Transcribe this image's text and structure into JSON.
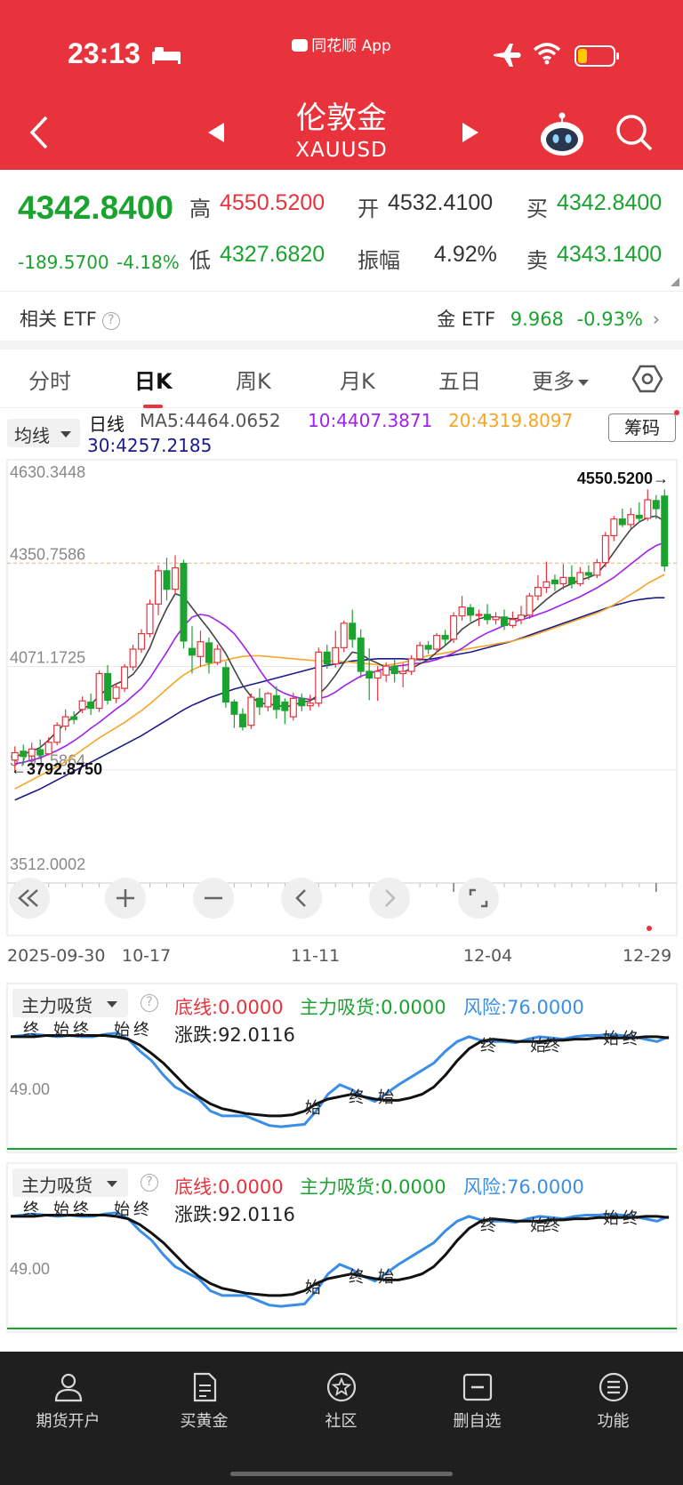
{
  "status_bar": {
    "time": "23:13",
    "app_name": "同花顺 App"
  },
  "header": {
    "title": "伦敦金",
    "subtitle": "XAUUSD"
  },
  "quote": {
    "price": "4342.8400",
    "change": "-189.5700",
    "change_pct": "-4.18%",
    "high_label": "高",
    "high": "4550.5200",
    "low_label": "低",
    "low": "4327.6820",
    "open_label": "开",
    "open": "4532.4100",
    "amp_label": "振幅",
    "amp": "4.92%",
    "buy_label": "买",
    "buy": "4342.8400",
    "sell_label": "卖",
    "sell": "4343.1400"
  },
  "etf": {
    "label": "相关 ETF",
    "name": "金 ETF",
    "value": "9.968",
    "pct": "-0.93%"
  },
  "tabs": [
    "分时",
    "日K",
    "周K",
    "月K",
    "五日",
    "更多"
  ],
  "ma": {
    "select": "均线",
    "prefix": "日线",
    "ma5": "MA5:4464.0652",
    "ma10": "10:4407.3871",
    "ma20": "20:4319.8097",
    "ma30": "30:4257.2185",
    "chip_button": "筹码"
  },
  "price_axis": [
    "4630.3448",
    "4350.7586",
    "4071.1725",
    "3791.5864",
    "3512.0002"
  ],
  "annotations": {
    "high_marker": "4550.5200→",
    "low_marker": "←3792.8750"
  },
  "dates": [
    "2025-09-30",
    "10-17",
    "11-11",
    "12-04",
    "12-29"
  ],
  "indicator": {
    "select": "主力吸货",
    "line_bottom": "底线:0.0000",
    "line_main": "主力吸货:0.0000",
    "line_risk": "风险:76.0000",
    "line_change": "涨跌:92.0116",
    "axis": "49.00",
    "marker_start": "始",
    "marker_end": "终"
  },
  "bottom_nav": [
    {
      "label": "期货开户",
      "icon": "person-icon"
    },
    {
      "label": "买黄金",
      "icon": "document-icon"
    },
    {
      "label": "社区",
      "icon": "community-icon"
    },
    {
      "label": "删自选",
      "icon": "remove-watch-icon"
    },
    {
      "label": "功能",
      "icon": "menu-icon"
    }
  ],
  "colors": {
    "brand": "#e8333c",
    "up": "#e8333c",
    "down": "#1aa32f",
    "ma5": "#444444",
    "ma10": "#a020f0",
    "ma20": "#f5a623",
    "ma30": "#1a1a8c",
    "risk": "#3a8ee6",
    "main": "#111111",
    "bottom_line": "#1aa32f"
  },
  "chart_data": [
    {
      "type": "candlestick",
      "title": "",
      "ylim": [
        3512.0002,
        4630.3448
      ],
      "y_ticks": [
        4630.3448,
        4350.7586,
        4071.1725,
        3791.5864,
        3512.0002
      ],
      "x_ticks": [
        "2025-09-30",
        "10-17",
        "11-11",
        "12-04",
        "12-29"
      ],
      "high_marker": 4550.52,
      "low_marker": 3792.875,
      "candles": [
        [
          3818,
          3838,
          3785,
          3855
        ],
        [
          3842,
          3828,
          3805,
          3860
        ],
        [
          3829,
          3848,
          3810,
          3865
        ],
        [
          3846,
          3832,
          3820,
          3874
        ],
        [
          3835,
          3866,
          3830,
          3880
        ],
        [
          3866,
          3912,
          3858,
          3920
        ],
        [
          3910,
          3935,
          3898,
          3955
        ],
        [
          3935,
          3928,
          3915,
          3950
        ],
        [
          3955,
          3978,
          3945,
          3990
        ],
        [
          3975,
          3958,
          3940,
          3998
        ],
        [
          3958,
          4052,
          3948,
          4060
        ],
        [
          4052,
          3980,
          3968,
          4075
        ],
        [
          3985,
          4015,
          3972,
          4025
        ],
        [
          4012,
          4070,
          4002,
          4078
        ],
        [
          4070,
          4118,
          4060,
          4130
        ],
        [
          4118,
          4160,
          4108,
          4172
        ],
        [
          4160,
          4240,
          4150,
          4252
        ],
        [
          4240,
          4330,
          4210,
          4345
        ],
        [
          4330,
          4280,
          4250,
          4365
        ],
        [
          4280,
          4338,
          4265,
          4372
        ],
        [
          4350,
          4140,
          4120,
          4360
        ],
        [
          4120,
          4102,
          4052,
          4180
        ],
        [
          4098,
          4138,
          4070,
          4168
        ],
        [
          4135,
          4082,
          4052,
          4150
        ],
        [
          4082,
          4118,
          4075,
          4130
        ],
        [
          4068,
          3975,
          3960,
          4085
        ],
        [
          3975,
          3942,
          3905,
          3982
        ],
        [
          3942,
          3908,
          3898,
          3958
        ],
        [
          3912,
          3988,
          3902,
          3998
        ],
        [
          3985,
          3962,
          3940,
          4012
        ],
        [
          3962,
          3998,
          3950,
          4002
        ],
        [
          3992,
          3955,
          3930,
          4018
        ],
        [
          3975,
          3952,
          3915,
          3985
        ],
        [
          3935,
          3985,
          3925,
          4000
        ],
        [
          3985,
          3965,
          3950,
          3998
        ],
        [
          3965,
          3972,
          3952,
          3995
        ],
        [
          3972,
          4110,
          3962,
          4122
        ],
        [
          4110,
          4078,
          4065,
          4130
        ],
        [
          4078,
          4122,
          4068,
          4168
        ],
        [
          4122,
          4188,
          4110,
          4195
        ],
        [
          4188,
          4145,
          4122,
          4225
        ],
        [
          4148,
          4058,
          4040,
          4172
        ],
        [
          4058,
          4040,
          3980,
          4120
        ],
        [
          4040,
          4058,
          3978,
          4072
        ],
        [
          4048,
          4072,
          4030,
          4082
        ],
        [
          4072,
          4052,
          4028,
          4092
        ],
        [
          4052,
          4058,
          4015,
          4080
        ],
        [
          4058,
          4092,
          4048,
          4102
        ],
        [
          4092,
          4128,
          4085,
          4138
        ],
        [
          4128,
          4118,
          4105,
          4140
        ],
        [
          4118,
          4155,
          4108,
          4162
        ],
        [
          4155,
          4145,
          4130,
          4170
        ],
        [
          4145,
          4208,
          4135,
          4218
        ],
        [
          4208,
          4232,
          4195,
          4262
        ],
        [
          4230,
          4210,
          4192,
          4240
        ],
        [
          4210,
          4212,
          4180,
          4225
        ],
        [
          4212,
          4198,
          4185,
          4240
        ],
        [
          4198,
          4205,
          4185,
          4218
        ],
        [
          4205,
          4182,
          4170,
          4225
        ],
        [
          4182,
          4198,
          4175,
          4220
        ],
        [
          4198,
          4210,
          4185,
          4235
        ],
        [
          4210,
          4262,
          4200,
          4270
        ],
        [
          4262,
          4285,
          4250,
          4318
        ],
        [
          4285,
          4300,
          4270,
          4355
        ],
        [
          4305,
          4295,
          4275,
          4320
        ],
        [
          4295,
          4312,
          4280,
          4348
        ],
        [
          4312,
          4295,
          4282,
          4345
        ],
        [
          4295,
          4325,
          4288,
          4340
        ],
        [
          4325,
          4318,
          4305,
          4345
        ],
        [
          4318,
          4352,
          4310,
          4362
        ],
        [
          4352,
          4425,
          4340,
          4435
        ],
        [
          4425,
          4470,
          4410,
          4478
        ],
        [
          4470,
          4455,
          4448,
          4498
        ],
        [
          4455,
          4482,
          4445,
          4500
        ],
        [
          4480,
          4472,
          4460,
          4515
        ],
        [
          4472,
          4522,
          4465,
          4550
        ],
        [
          4520,
          4498,
          4470,
          4535
        ],
        [
          4532,
          4343,
          4328,
          4550
        ]
      ],
      "ma5": [
        3828,
        3834,
        3842,
        3852,
        3872,
        3896,
        3918,
        3936,
        3956,
        3968,
        3992,
        4012,
        4024,
        4034,
        4050,
        4080,
        4122,
        4180,
        4228,
        4268,
        4260,
        4230,
        4200,
        4172,
        4140,
        4106,
        4062,
        4020,
        3990,
        3972,
        3970,
        3966,
        3962,
        3966,
        3975,
        3978,
        3995,
        4018,
        4048,
        4082,
        4110,
        4105,
        4090,
        4080,
        4068,
        4058,
        4056,
        4066,
        4078,
        4090,
        4110,
        4128,
        4148,
        4172,
        4188,
        4200,
        4206,
        4205,
        4202,
        4200,
        4202,
        4212,
        4232,
        4252,
        4270,
        4285,
        4295,
        4305,
        4312,
        4322,
        4348,
        4380,
        4412,
        4442,
        4462,
        4474,
        4478,
        4464
      ],
      "ma10": [
        3808,
        3812,
        3818,
        3824,
        3834,
        3844,
        3856,
        3870,
        3886,
        3904,
        3920,
        3938,
        3956,
        3972,
        3992,
        4012,
        4040,
        4075,
        4110,
        4148,
        4180,
        4205,
        4212,
        4208,
        4195,
        4180,
        4160,
        4130,
        4098,
        4062,
        4030,
        4010,
        3998,
        3990,
        3985,
        3982,
        3984,
        3990,
        4002,
        4018,
        4032,
        4045,
        4052,
        4060,
        4066,
        4072,
        4074,
        4078,
        4080,
        4084,
        4090,
        4098,
        4108,
        4120,
        4136,
        4150,
        4162,
        4172,
        4182,
        4190,
        4198,
        4204,
        4212,
        4220,
        4230,
        4240,
        4250,
        4260,
        4272,
        4284,
        4298,
        4312,
        4330,
        4348,
        4366,
        4384,
        4398,
        4407
      ],
      "ma20": [
        3740,
        3752,
        3764,
        3776,
        3788,
        3800,
        3814,
        3830,
        3846,
        3862,
        3878,
        3892,
        3906,
        3920,
        3936,
        3952,
        3970,
        3990,
        4010,
        4030,
        4048,
        4062,
        4072,
        4078,
        4084,
        4088,
        4094,
        4098,
        4100,
        4100,
        4098,
        4096,
        4094,
        4092,
        4090,
        4088,
        4086,
        4086,
        4086,
        4084,
        4082,
        4080,
        4078,
        4076,
        4074,
        4078,
        4082,
        4088,
        4094,
        4100,
        4104,
        4108,
        4112,
        4116,
        4120,
        4124,
        4128,
        4132,
        4136,
        4140,
        4146,
        4152,
        4160,
        4168,
        4176,
        4184,
        4192,
        4200,
        4208,
        4216,
        4226,
        4238,
        4252,
        4266,
        4280,
        4296,
        4308,
        4320
      ],
      "ma30": [
        3710,
        3720,
        3730,
        3740,
        3752,
        3764,
        3776,
        3788,
        3800,
        3812,
        3824,
        3836,
        3848,
        3860,
        3872,
        3884,
        3898,
        3912,
        3926,
        3940,
        3954,
        3966,
        3976,
        3986,
        3994,
        4002,
        4010,
        4016,
        4022,
        4028,
        4034,
        4040,
        4046,
        4052,
        4058,
        4064,
        4070,
        4074,
        4078,
        4082,
        4086,
        4088,
        4090,
        4092,
        4092,
        4092,
        4092,
        4090,
        4090,
        4090,
        4094,
        4098,
        4102,
        4106,
        4110,
        4116,
        4122,
        4128,
        4134,
        4140,
        4148,
        4156,
        4164,
        4172,
        4180,
        4188,
        4196,
        4204,
        4212,
        4220,
        4228,
        4236,
        4242,
        4248,
        4252,
        4255,
        4257,
        4257
      ]
    },
    {
      "type": "line",
      "title": "",
      "y_ticks": [
        49.0
      ],
      "ylim": [
        0,
        100
      ],
      "series": [
        {
          "name": "风险",
          "values": [
            92,
            93,
            94,
            93,
            92,
            93,
            92,
            92,
            94,
            95,
            90,
            80,
            72,
            60,
            50,
            45,
            40,
            30,
            26,
            26,
            26,
            22,
            18,
            17,
            18,
            19,
            30,
            44,
            52,
            48,
            42,
            38,
            45,
            52,
            58,
            64,
            70,
            80,
            88,
            92,
            89,
            88,
            88,
            87,
            90,
            92,
            91,
            90,
            92,
            93,
            93,
            94,
            93,
            92,
            90,
            88,
            92
          ]
        },
        {
          "name": "主力吸货",
          "values": [
            92,
            92,
            92,
            93,
            93,
            93,
            93,
            93,
            93,
            92,
            90,
            85,
            78,
            70,
            60,
            50,
            42,
            36,
            32,
            30,
            28,
            27,
            26,
            26,
            27,
            30,
            36,
            40,
            42,
            44,
            42,
            40,
            39,
            39,
            41,
            44,
            50,
            60,
            72,
            82,
            88,
            90,
            89,
            88,
            88,
            88,
            89,
            89,
            90,
            90,
            91,
            91,
            91,
            91,
            92,
            92,
            91
          ]
        }
      ],
      "bottom_line": 0
    }
  ]
}
